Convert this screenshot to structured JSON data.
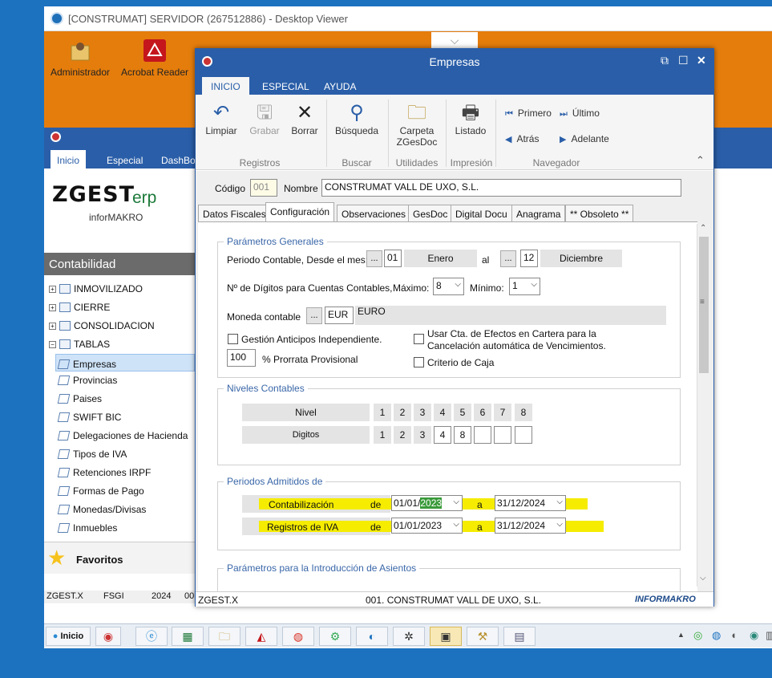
{
  "viewer": {
    "title": "[CONSTRUMAT] SERVIDOR (267512886) - Desktop Viewer"
  },
  "desktop_icons": [
    {
      "label": "Administrador",
      "icon": "folder-user-icon"
    },
    {
      "label": "Acrobat Reader",
      "icon": "acrobat-icon"
    }
  ],
  "zgest": {
    "tabs": [
      "Inicio",
      "Especial",
      "DashBo"
    ],
    "logo": "ZGEST",
    "logo_suffix": "erp",
    "logo_sub": "inforMAKRO",
    "section": "Contabilidad",
    "tree": [
      {
        "sign": "+",
        "label": "INMOVILIZADO"
      },
      {
        "sign": "+",
        "label": "CIERRE"
      },
      {
        "sign": "+",
        "label": "CONSOLIDACION"
      },
      {
        "sign": "−",
        "label": "TABLAS"
      }
    ],
    "subitems": [
      "Empresas",
      "Provincias",
      "Paises",
      "SWIFT BIC",
      "Delegaciones de Hacienda",
      "Tipos de IVA",
      "Retenciones IRPF",
      "Formas de Pago",
      "Monedas/Divisas",
      "Inmuebles"
    ],
    "favorites": "Favoritos",
    "status": [
      "ZGEST.X",
      "FSGI",
      "2024",
      "00"
    ]
  },
  "dialog": {
    "title": "Empresas",
    "ribbon_tabs": [
      "INICIO",
      "ESPECIAL",
      "AYUDA"
    ],
    "buttons": {
      "limpiar": "Limpiar",
      "grabar": "Grabar",
      "borrar": "Borrar",
      "busqueda": "Búsqueda",
      "carpeta": "Carpeta",
      "carpeta2": "ZGesDoc",
      "listado": "Listado",
      "primero": "Primero",
      "ultimo": "Último",
      "atras": "Atrás",
      "adelante": "Adelante"
    },
    "groups": [
      "Registros",
      "Buscar",
      "Utilidades",
      "Impresión",
      "Navegador"
    ],
    "codigo_label": "Código",
    "codigo_value": "001",
    "nombre_label": "Nombre",
    "nombre_value": "CONSTRUMAT VALL DE UXO, S.L.",
    "form_tabs": [
      "Datos Fiscales",
      "Configuración",
      "Observaciones",
      "GesDoc",
      "Digital Docu",
      "Anagrama",
      "** Obsoleto **"
    ],
    "generales": {
      "legend": "Parámetros Generales",
      "periodo_label": "Periodo Contable, Desde el mes:",
      "desde_num": "01",
      "desde_mes": "Enero",
      "al": "al",
      "hasta_num": "12",
      "hasta_mes": "Diciembre",
      "digitos_label": "Nº de Dígitos para Cuentas Contables,",
      "maximo_label": "Máximo:",
      "maximo": "8",
      "minimo_label": "Mínimo:",
      "minimo": "1",
      "moneda_label": "Moneda contable",
      "moneda_code": "EUR",
      "moneda_name": "EURO",
      "anticipos": "Gestión Anticipos Independiente.",
      "prorrata_value": "100",
      "prorrata_label": "% Prorrata Provisional",
      "efectos_1": "Usar Cta. de Efectos en Cartera para la",
      "efectos_2": "Cancelación automática de Vencimientos.",
      "criterio": "Criterio de Caja",
      "dots": "..."
    },
    "niveles": {
      "legend": "Niveles Contables",
      "nivel_label": "Nivel",
      "digitos_label": "Digitos",
      "nivel": [
        "1",
        "2",
        "3",
        "4",
        "5",
        "6",
        "7",
        "8"
      ],
      "digitos": [
        "1",
        "2",
        "3",
        "4",
        "8",
        "",
        "",
        ""
      ]
    },
    "periodos": {
      "legend": "Periodos Admitidos de",
      "rows": [
        {
          "label": "Contabilización",
          "de": "de",
          "from_prefix": "01/01/",
          "from_year": "2023",
          "a": "a",
          "to": "31/12/2024"
        },
        {
          "label": "Registros de IVA",
          "de": "de",
          "from": "01/01/2023",
          "a": "a",
          "to": "31/12/2024"
        }
      ]
    },
    "asientos": {
      "legend": "Parámetros para la Introducción de Asientos"
    },
    "status_left": "ZGEST.X",
    "status_mid": "001. CONSTRUMAT VALL DE UXO, S.L.",
    "status_brand": "INFORMAKRO"
  },
  "taskbar": {
    "start": "Inicio"
  }
}
